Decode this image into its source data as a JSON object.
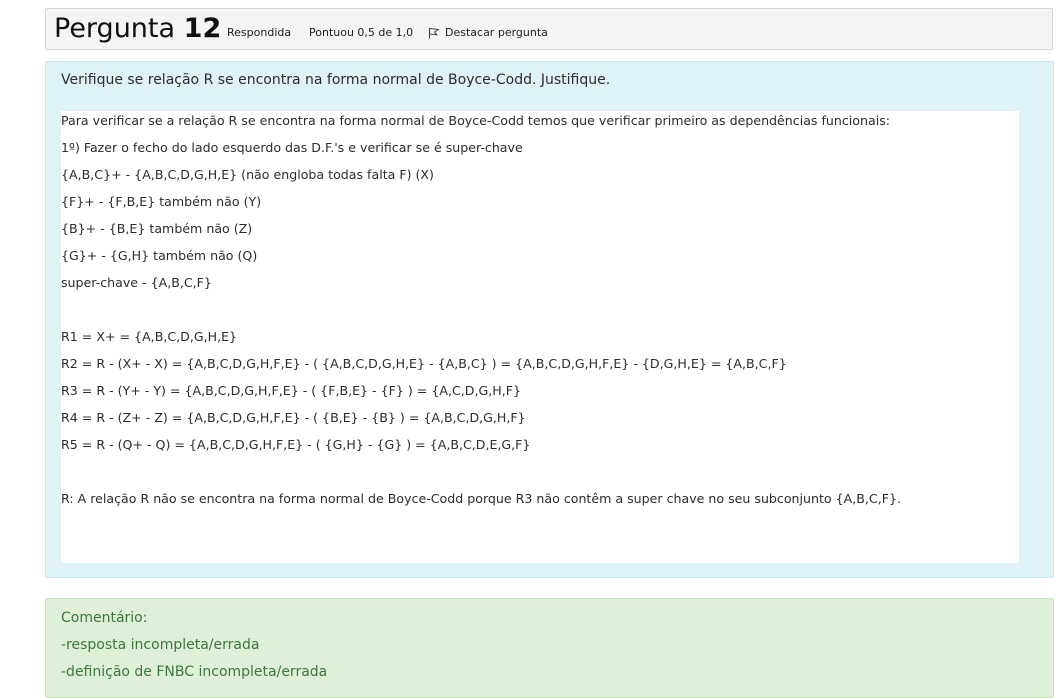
{
  "question": {
    "label": "Pergunta",
    "number": "12",
    "status": "Respondida",
    "grade": "Pontuou 0,5 de 1,0",
    "flag_label": "Destacar pergunta",
    "flag_icon": "flag-icon",
    "text": "Verifique se relação R se encontra na forma normal de Boyce-Codd. Justifique."
  },
  "answer": {
    "lines": [
      "Para verificar se a relação R se encontra na forma normal de Boyce-Codd temos que verificar primeiro as dependências funcionais:",
      "1º) Fazer o fecho do lado esquerdo das D.F.'s e verificar se é super-chave",
      "{A,B,C}+ - {A,B,C,D,G,H,E}  (não engloba todas falta F)     (X)",
      "{F}+ - {F,B,E} também não (Y)",
      "{B}+ - {B,E} também não (Z)",
      "{G}+ - {G,H} também não (Q)",
      "super-chave - {A,B,C,F}",
      "",
      "R1 = X+ = {A,B,C,D,G,H,E}",
      "R2 = R - (X+ - X) =  {A,B,C,D,G,H,F,E} - ( {A,B,C,D,G,H,E} - {A,B,C} ) = {A,B,C,D,G,H,F,E} - {D,G,H,E} = {A,B,C,F}",
      "R3 = R - (Y+ - Y) =  {A,B,C,D,G,H,F,E} - ( {F,B,E} - {F} ) = {A,C,D,G,H,F}",
      "R4 = R - (Z+ - Z) = {A,B,C,D,G,H,F,E} - ( {B,E} - {B} ) = {A,B,C,D,G,H,F}",
      "R5 = R - (Q+ - Q) = {A,B,C,D,G,H,F,E} - ( {G,H} - {G} ) = {A,B,C,D,E,G,F}",
      "",
      "R: A relação R não se encontra na forma normal de Boyce-Codd porque R3 não contêm a super chave no seu subconjunto {A,B,C,F}."
    ]
  },
  "comment": {
    "title": "Comentário:",
    "lines": [
      "-resposta incompleta/errada",
      "-definição de FNBC incompleta/errada"
    ]
  },
  "colors": {
    "info_bg": "#def2f8",
    "feedback_bg": "#dff0d8",
    "feedback_text": "#3c763d"
  }
}
